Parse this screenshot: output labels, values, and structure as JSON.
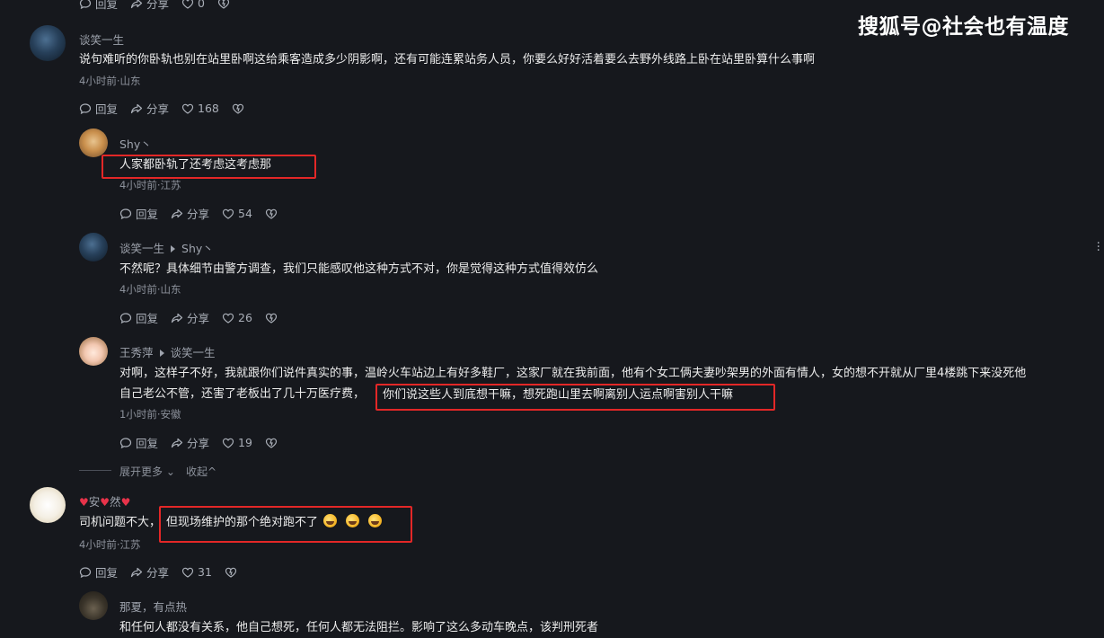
{
  "watermark": "搜狐号@社会也有温度",
  "actions": {
    "reply": "回复",
    "share": "分享"
  },
  "top_partial": {
    "likes": "0"
  },
  "comments": [
    {
      "user": "谈笑一生",
      "text": "说句难听的你卧轨也别在站里卧啊这给乘客造成多少阴影啊，还有可能连累站务人员，你要么好好活着要么去野外线路上卧在站里卧算什么事啊",
      "meta": "4小时前·山东",
      "likes": "168"
    },
    {
      "user": "Shy丶",
      "text": "人家都卧轨了还考虑这考虑那",
      "meta": "4小时前·江苏",
      "likes": "54"
    },
    {
      "user": "谈笑一生",
      "reply_to": "Shy丶",
      "text": "不然呢？具体细节由警方调查，我们只能感叹他这种方式不对，你是觉得这种方式值得效仿么",
      "meta": "4小时前·山东",
      "likes": "26"
    },
    {
      "user": "王秀萍",
      "reply_to": "谈笑一生",
      "text_line1": "对啊，这样子不好，我就跟你们说件真实的事，温岭火车站边上有好多鞋厂，这家厂就在我前面，他有个女工俩夫妻吵架男的外面有情人，女的想不开就从厂里4楼跳下来没死他",
      "text_line2a": "自己老公不管，还害了老板出了几十万医疗费，",
      "text_line2b": "你们说这些人到底想干嘛，想死跑山里去啊离别人运点啊害别人干嘛",
      "meta": "1小时前·安徽",
      "likes": "19"
    },
    {
      "user_mid": "安",
      "user_end": "然",
      "text_a": "司机问题不大，",
      "text_b": "但现场维护的那个绝对跑不了",
      "meta": "4小时前·江苏",
      "likes": "31"
    },
    {
      "user": "那夏，有点热",
      "text": "和任何人都没有关系，他自己想死，任何人都无法阻拦。影响了这么多动车晚点，该判刑死者"
    }
  ],
  "expand_more": "展开更多",
  "collapse": "收起",
  "icons": [
    "reply-icon",
    "share-icon",
    "like-icon",
    "dislike-icon",
    "more-dots-icon",
    "laugh-emoji-icon"
  ]
}
